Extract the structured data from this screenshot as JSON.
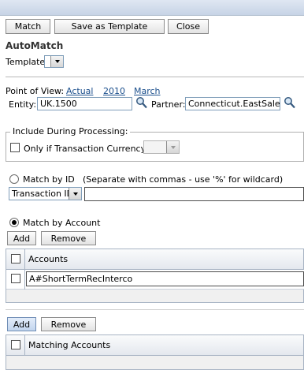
{
  "toolbar": {
    "match_label": "Match",
    "save_template_label": "Save as Template",
    "close_label": "Close"
  },
  "page_title": "AutoMatch",
  "template": {
    "label": "Template:",
    "value": ""
  },
  "pov": {
    "label": "Point of View:",
    "scenario": "Actual",
    "year": "2010",
    "period": "March",
    "entity_label": "Entity:",
    "entity_value": "UK.1500",
    "partner_label": "Partner:",
    "partner_value": "Connecticut.EastSales"
  },
  "include": {
    "legend": "Include During Processing:",
    "currency_label": "Only if Transaction Currency =",
    "currency_value": ""
  },
  "match_by_id": {
    "label": "Match by ID",
    "hint": "(Separate with commas - use '%' for wildcard)",
    "selected_field": "Transaction ID",
    "value": ""
  },
  "match_by_account": {
    "label": "Match by Account",
    "add_label": "Add",
    "remove_label": "Remove",
    "header": "Accounts",
    "rows": [
      "A#ShortTermRecInterco"
    ]
  },
  "matching_accounts": {
    "add_label": "Add",
    "remove_label": "Remove",
    "header": "Matching Accounts"
  },
  "icons": [
    "magnifier-icon",
    "dropdown-arrow-icon",
    "checkbox-icon",
    "radio-icon"
  ]
}
